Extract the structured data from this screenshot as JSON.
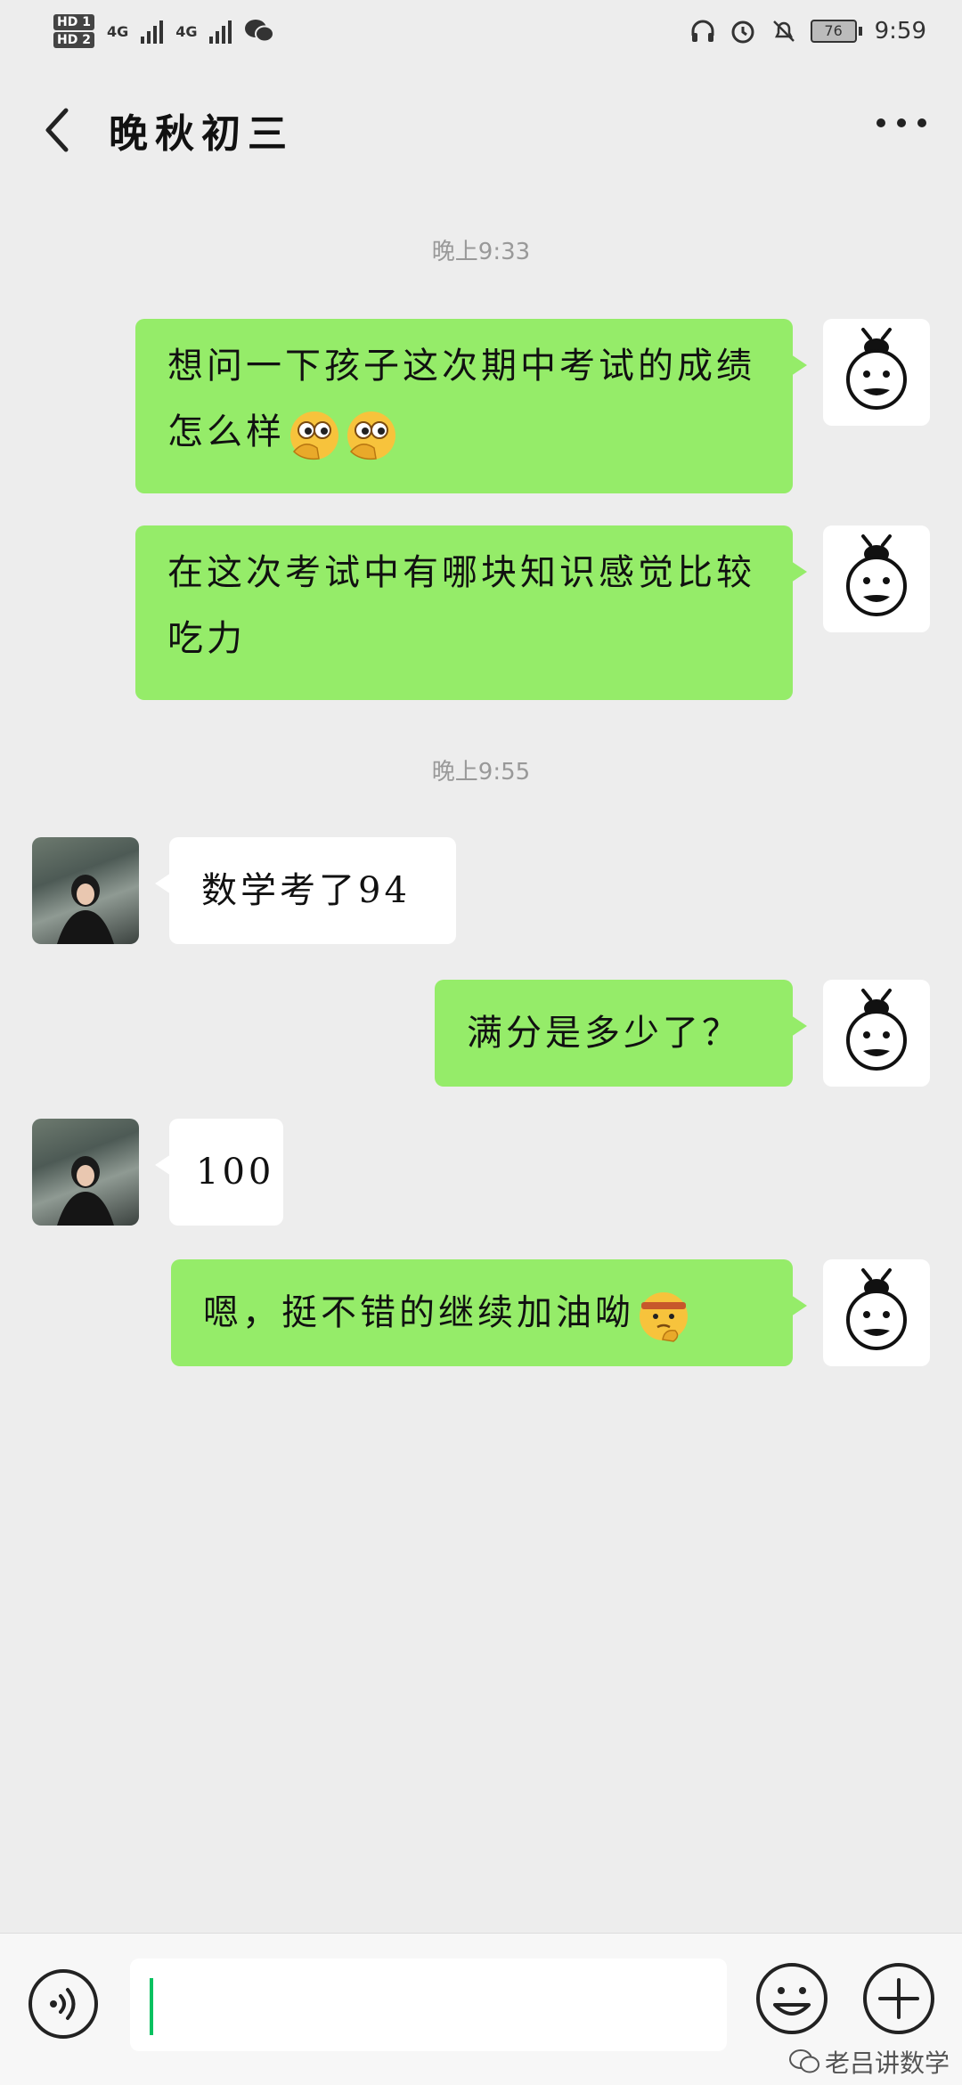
{
  "status_bar": {
    "hd1": "HD 1",
    "hd2": "HD 2",
    "net1": "4G",
    "net2": "4G",
    "battery": "76",
    "time": "9:59"
  },
  "header": {
    "title": "晚秋初三"
  },
  "messages": [
    {
      "type": "timestamp",
      "text": "晚上9:33"
    },
    {
      "type": "sent",
      "text": "想问一下孩子这次期中考试的成绩怎么样",
      "emojis": [
        "facepalm-peek-emoji",
        "facepalm-peek-emoji"
      ]
    },
    {
      "type": "sent",
      "text": "在这次考试中有哪块知识感觉比较吃力"
    },
    {
      "type": "timestamp",
      "text": "晚上9:55"
    },
    {
      "type": "received",
      "text": "数学考了94"
    },
    {
      "type": "sent",
      "text": "满分是多少了？"
    },
    {
      "type": "received",
      "text": "100"
    },
    {
      "type": "sent",
      "text": "嗯，挺不错的继续加油呦",
      "emojis": [
        "headband-thinking-emoji"
      ]
    }
  ],
  "watermark": "老吕讲数学",
  "colors": {
    "background": "#ededed",
    "sent_bubble": "#95ec69",
    "received_bubble": "#ffffff",
    "caret": "#07c160"
  }
}
